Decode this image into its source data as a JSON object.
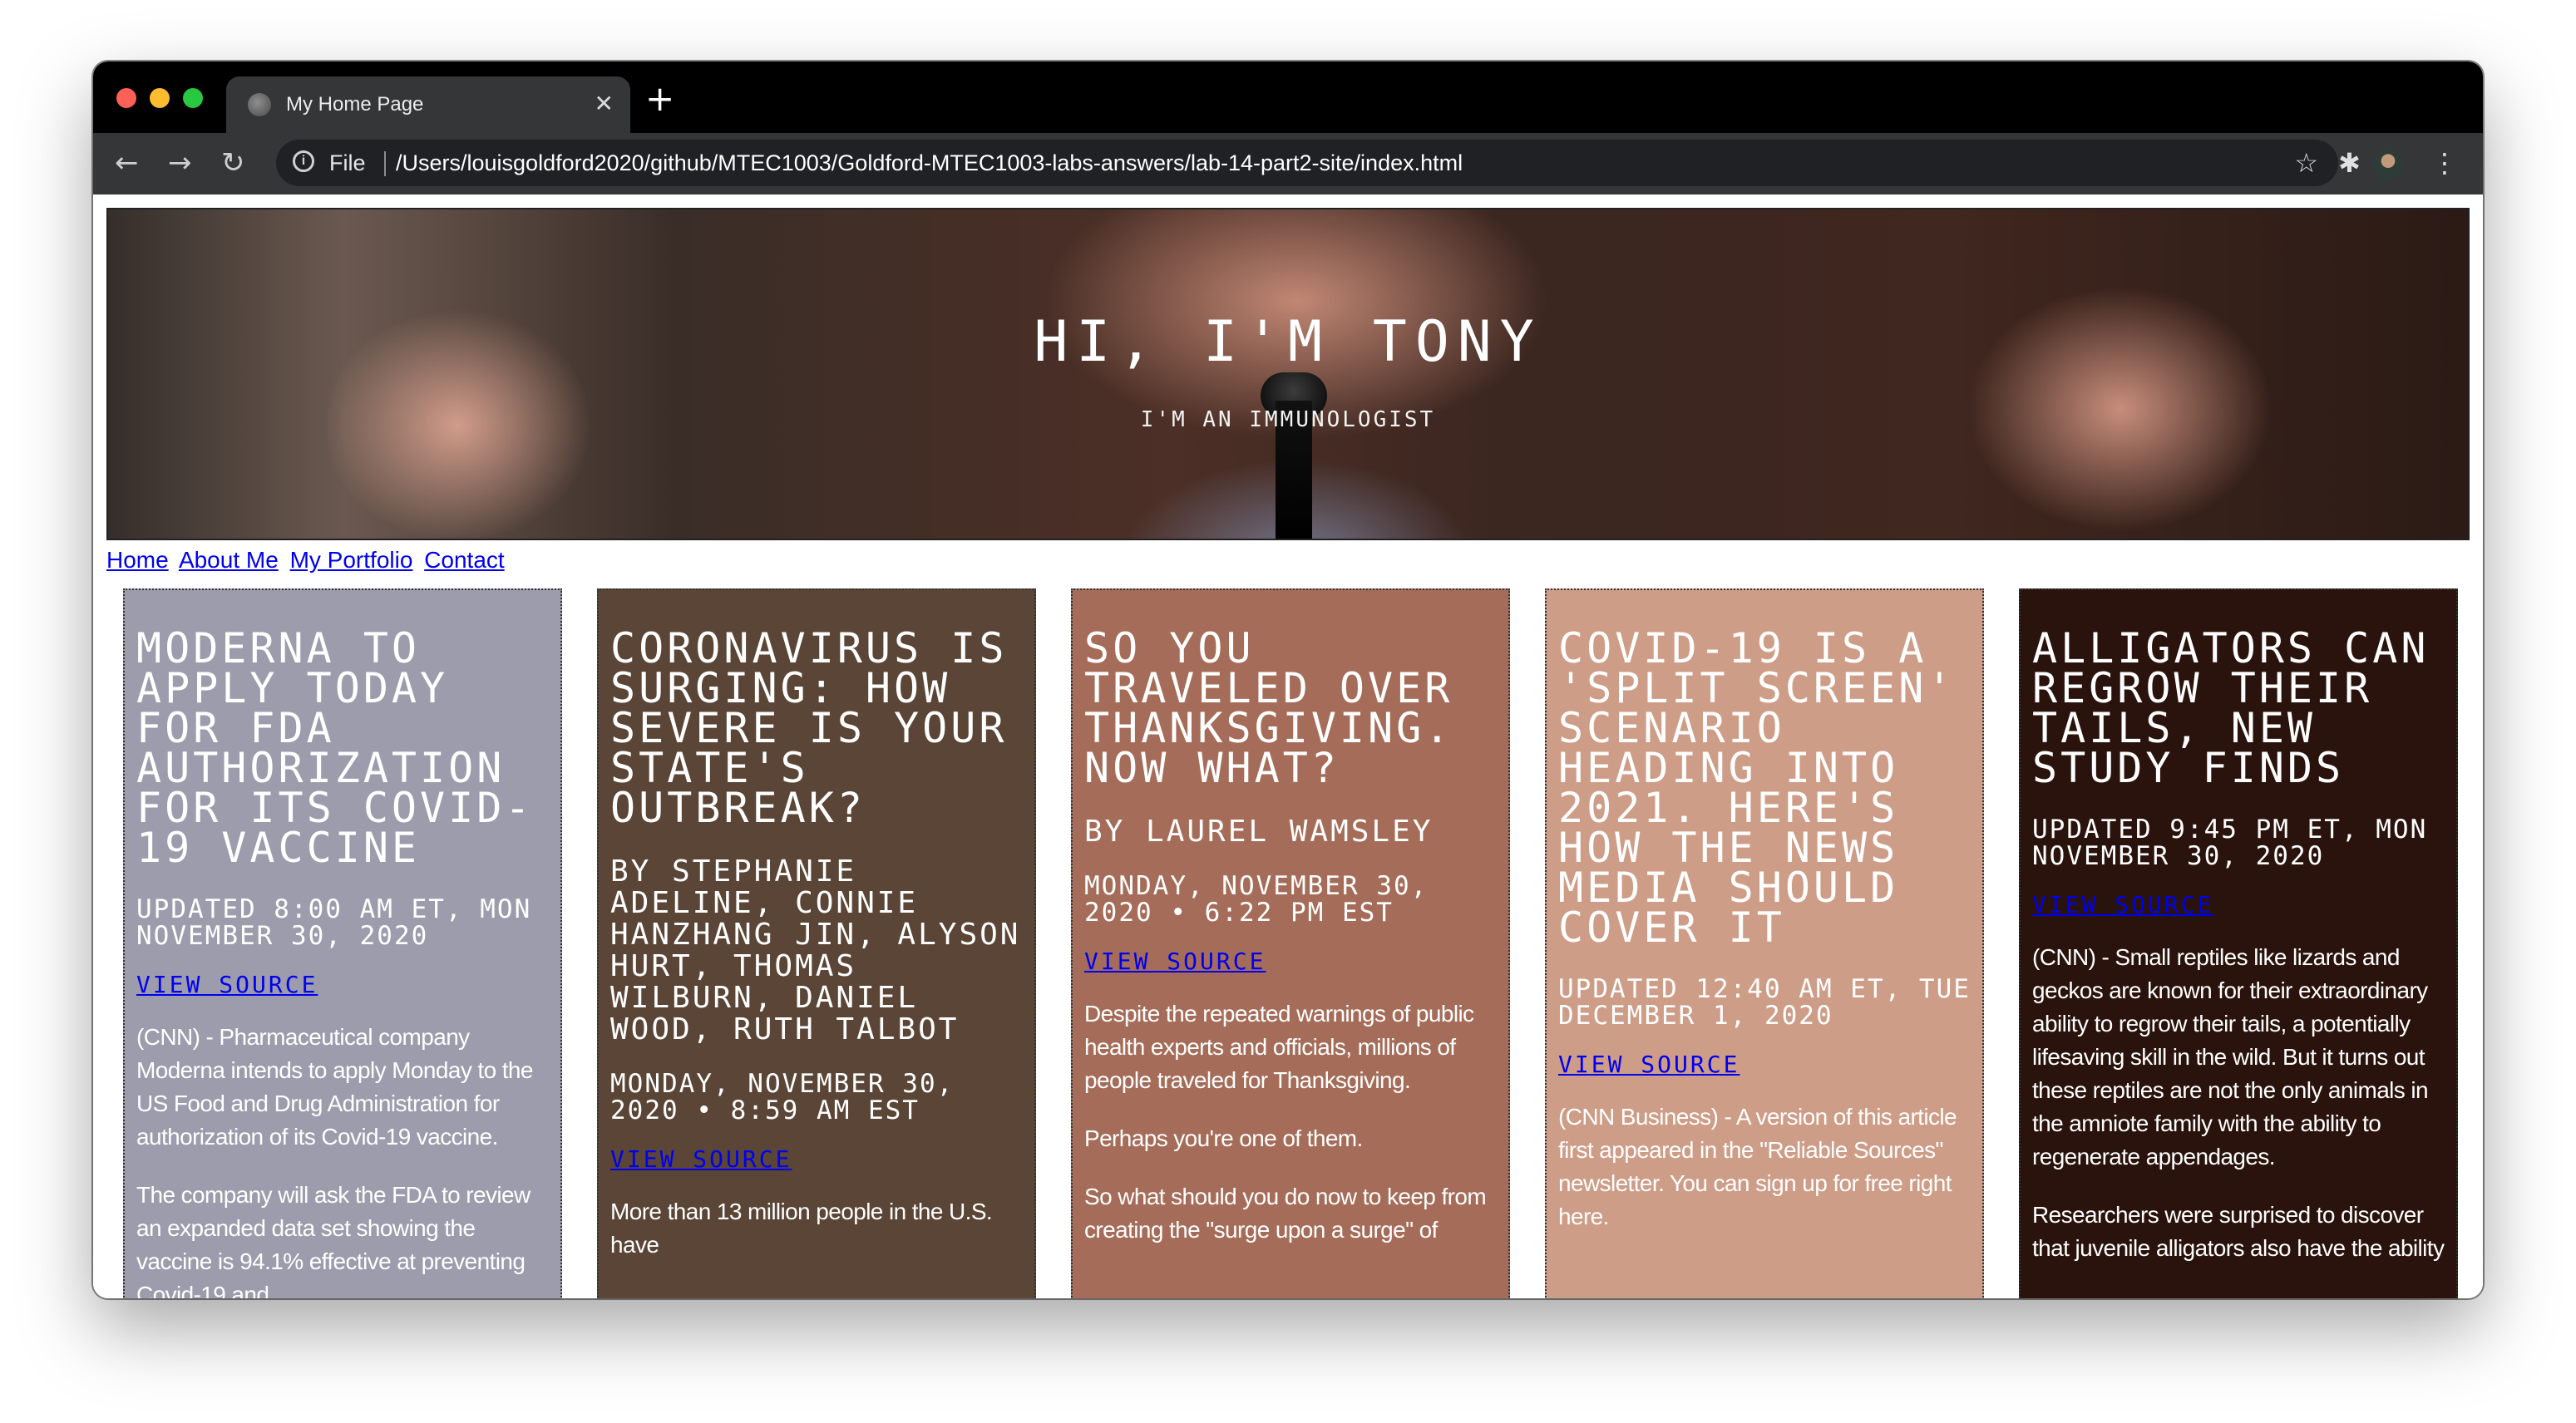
{
  "browser": {
    "tab_title": "My Home Page",
    "tab_close": "✕",
    "new_tab": "+",
    "back": "←",
    "forward": "→",
    "reload": "↻",
    "info": "i",
    "scheme_label": "File",
    "url": "/Users/louisgoldford2020/github/MTEC1003/Goldford-MTEC1003-labs-answers/lab-14-part2-site/index.html",
    "bookmark": "☆",
    "extensions": "✱",
    "menu": "⋮",
    "icons": [
      "globe-icon",
      "close-icon",
      "plus-icon",
      "back-arrow-icon",
      "forward-arrow-icon",
      "reload-icon",
      "info-icon",
      "star-icon",
      "puzzle-icon",
      "kebab-menu-icon"
    ]
  },
  "hero": {
    "title": "Hi, I'm Tony",
    "subtitle": "I'm an immunologist"
  },
  "nav": [
    {
      "label": "Home"
    },
    {
      "label": "About Me"
    },
    {
      "label": "My Portfolio"
    },
    {
      "label": "Contact"
    }
  ],
  "cards": [
    {
      "title": "Moderna to apply today for FDA authorization for its Covid-19 vaccine",
      "author": "",
      "meta": "Updated 8:00 AM ET, Mon November 30, 2020",
      "source": "View Source",
      "paragraphs": [
        "(CNN) - Pharmaceutical company Moderna intends to apply Monday to the US Food and Drug Administration for authorization of its Covid-19 vaccine.",
        "The company will ask the FDA to review an expanded data set showing the vaccine is 94.1% effective at preventing Covid-19 and"
      ],
      "bg": "#9c9cad"
    },
    {
      "title": "Coronavirus is surging: How severe is your state's outbreak?",
      "author": "By Stephanie Adeline, Connie Hanzhang Jin, Alyson Hurt, Thomas Wilburn, Daniel Wood, Ruth Talbot",
      "meta": "Monday, November 30, 2020 • 8:59 AM EST",
      "source": "View Source",
      "paragraphs": [
        "More than 13 million people in the U.S. have"
      ],
      "bg": "#5a4536"
    },
    {
      "title": "So you traveled over Thanksgiving. Now what?",
      "author": "By Laurel Wamsley",
      "meta": "Monday, November 30, 2020 • 6:22 PM EST",
      "source": "View Source",
      "paragraphs": [
        "Despite the repeated warnings of public health experts and officials, millions of people traveled for Thanksgiving.",
        "Perhaps you're one of them.",
        "So what should you do now to keep from creating the \"surge upon a surge\" of"
      ],
      "bg": "#a56d59"
    },
    {
      "title": "Covid-19 is a 'split screen' scenario heading into 2021. Here's how the news media should cover it",
      "author": "",
      "meta": "Updated 12:40 AM ET, Tue December 1, 2020",
      "source": "View Source",
      "paragraphs": [
        "(CNN Business) - A version of this article first appeared in the \"Reliable Sources\" newsletter. You can sign up for free right here."
      ],
      "bg": "#ce9d87"
    },
    {
      "title": "Alligators can regrow their tails, new study finds",
      "author": "",
      "meta": "Updated 9:45 PM ET, Mon November 30, 2020",
      "source": "View Source",
      "paragraphs": [
        "(CNN) - Small reptiles like lizards and geckos are known for their extraordinary ability to regrow their tails, a potentially lifesaving skill in the wild. But it turns out these reptiles are not the only animals in the amniote family with the ability to regenerate appendages.",
        "Researchers were surprised to discover that juvenile alligators also have the ability"
      ],
      "bg": "#2a130c"
    }
  ]
}
